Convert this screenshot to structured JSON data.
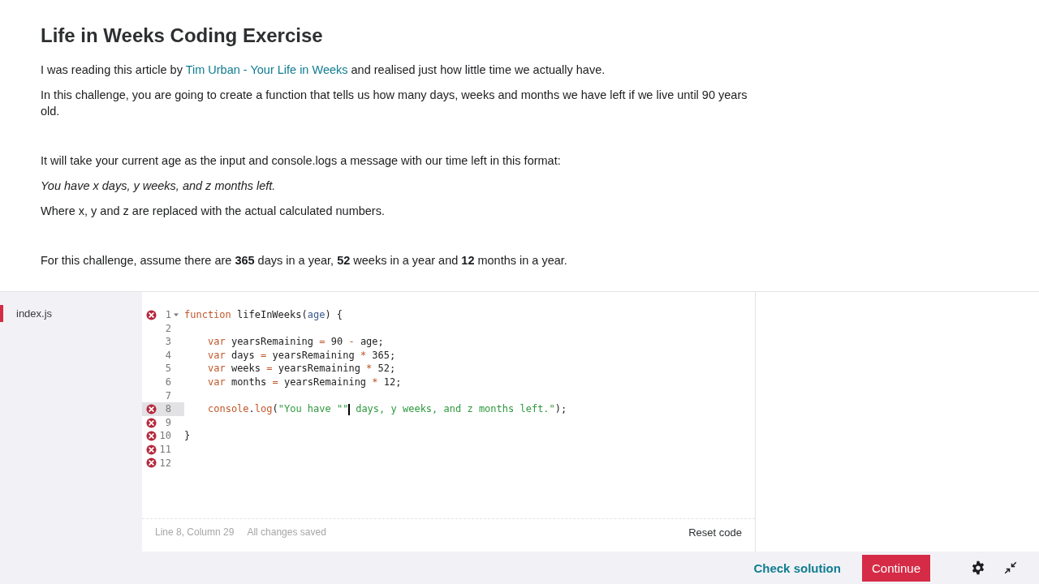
{
  "title": "Life in Weeks Coding Exercise",
  "paragraphs": [
    {
      "kind": "link",
      "gap_before": false,
      "before": "I was reading this article by",
      "link": "Tim Urban - Your Life in Weeks",
      "after": "and realised just how little time we actually have."
    },
    {
      "kind": "plain",
      "gap_before": false,
      "text": "In this challenge, you are going to create a function that tells us how many days, weeks and months we have left if we live until 90 years old."
    },
    {
      "kind": "plain",
      "gap_before": true,
      "text": "It will take your current age as the input and console.logs a message with our time left in this format:"
    },
    {
      "kind": "italic",
      "gap_before": false,
      "text": "You have x days, y weeks, and z months left."
    },
    {
      "kind": "plain",
      "gap_before": false,
      "text": "Where x, y and z are replaced with the actual calculated numbers."
    },
    {
      "kind": "plain",
      "gap_before": true,
      "text": "For this challenge, assume there are **365** days in a year, **52** weeks in a year and **12** months in a year."
    }
  ],
  "files": [
    {
      "name": "index.js",
      "selected": true
    }
  ],
  "code": [
    {
      "number": "1",
      "error": true,
      "active": false,
      "foldable": true,
      "indent": false,
      "tokens": [
        {
          "kind": "keyword",
          "text": "function"
        },
        {
          "kind": "name",
          "text": " lifeInWeeks("
        },
        {
          "kind": "param",
          "text": "age"
        },
        {
          "kind": "name",
          "text": ") {"
        }
      ]
    },
    {
      "number": "2",
      "error": false,
      "active": false,
      "foldable": false
    },
    {
      "number": "3",
      "error": false,
      "active": false,
      "foldable": false,
      "indent": true,
      "tokens": [
        {
          "kind": "keyword",
          "text": "var"
        },
        {
          "kind": "name",
          "text": " yearsRemaining "
        },
        {
          "kind": "op",
          "text": "="
        },
        {
          "kind": "name",
          "text": " 90 "
        },
        {
          "kind": "op",
          "text": "-"
        },
        {
          "kind": "name",
          "text": " age;"
        }
      ]
    },
    {
      "number": "4",
      "error": false,
      "active": false,
      "foldable": false,
      "indent": true,
      "tokens": [
        {
          "kind": "keyword",
          "text": "var"
        },
        {
          "kind": "name",
          "text": " days "
        },
        {
          "kind": "op",
          "text": "="
        },
        {
          "kind": "name",
          "text": " yearsRemaining "
        },
        {
          "kind": "op",
          "text": "*"
        },
        {
          "kind": "name",
          "text": " 365;"
        }
      ]
    },
    {
      "number": "5",
      "error": false,
      "active": false,
      "foldable": false,
      "indent": true,
      "tokens": [
        {
          "kind": "keyword",
          "text": "var"
        },
        {
          "kind": "name",
          "text": " weeks "
        },
        {
          "kind": "op",
          "text": "="
        },
        {
          "kind": "name",
          "text": " yearsRemaining "
        },
        {
          "kind": "op",
          "text": "*"
        },
        {
          "kind": "name",
          "text": " 52;"
        }
      ]
    },
    {
      "number": "6",
      "error": false,
      "active": false,
      "foldable": false,
      "indent": true,
      "tokens": [
        {
          "kind": "keyword",
          "text": "var"
        },
        {
          "kind": "name",
          "text": " months "
        },
        {
          "kind": "op",
          "text": "="
        },
        {
          "kind": "name",
          "text": " yearsRemaining "
        },
        {
          "kind": "op",
          "text": "*"
        },
        {
          "kind": "name",
          "text": " 12;"
        }
      ]
    },
    {
      "number": "7",
      "error": false,
      "active": false,
      "foldable": false
    },
    {
      "number": "8",
      "error": true,
      "active": true,
      "foldable": false,
      "indent": true,
      "tokens": [
        {
          "kind": "keyword",
          "text": "console"
        },
        {
          "kind": "name",
          "text": "."
        },
        {
          "kind": "keyword",
          "text": "log"
        },
        {
          "kind": "name",
          "text": "("
        },
        {
          "kind": "string",
          "text": "\"You have \"\"",
          "caret": true
        },
        {
          "kind": "string",
          "text": " days, y weeks, and z months left.\""
        },
        {
          "kind": "name",
          "text": ");"
        }
      ]
    },
    {
      "number": "9",
      "error": true,
      "active": false,
      "foldable": false
    },
    {
      "number": "10",
      "error": true,
      "active": false,
      "foldable": false,
      "indent": false,
      "tokens": [
        {
          "kind": "name",
          "text": "}"
        }
      ]
    },
    {
      "number": "11",
      "error": true,
      "active": false,
      "foldable": false
    },
    {
      "number": "12",
      "error": true,
      "active": false,
      "foldable": false
    }
  ],
  "status": {
    "position": "Line 8, Column 29",
    "saved": "All changes saved",
    "reset": "Reset code"
  },
  "footer": {
    "check": "Check solution",
    "continue": "Continue"
  }
}
